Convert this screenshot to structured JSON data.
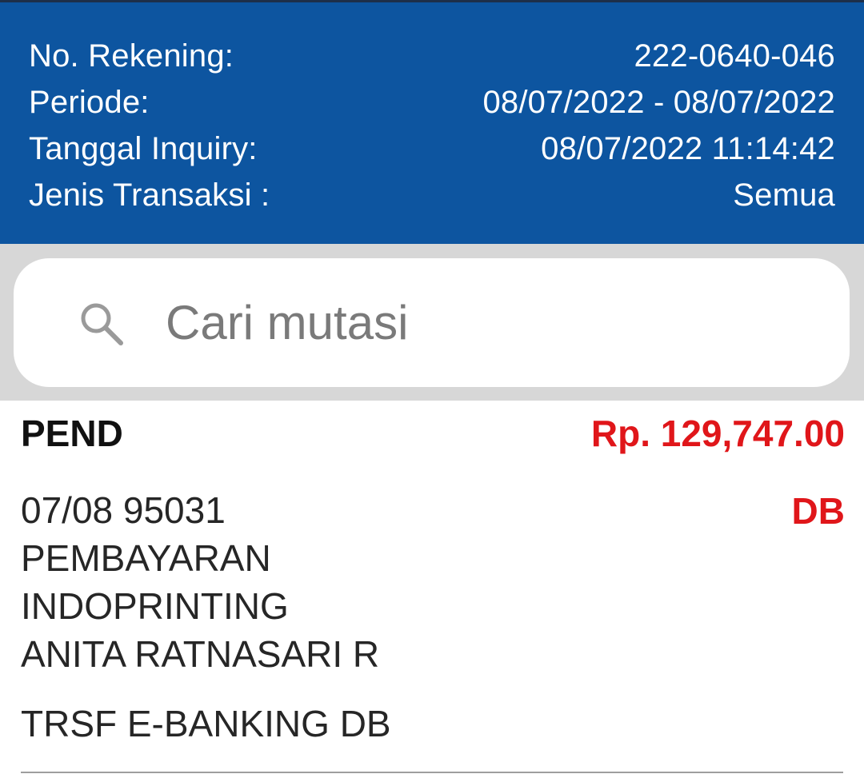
{
  "account_info": [
    {
      "label": "No. Rekening:",
      "value": "222-0640-046"
    },
    {
      "label": "Periode:",
      "value": "08/07/2022 - 08/07/2022"
    },
    {
      "label": "Tanggal Inquiry:",
      "value": "08/07/2022 11:14:42"
    },
    {
      "label": "Jenis Transaksi :",
      "value": "Semua"
    }
  ],
  "search": {
    "placeholder": "Cari mutasi",
    "icon": "search-icon"
  },
  "transaction": {
    "type": "PEND",
    "amount": "Rp. 129,747.00",
    "dc": "DB",
    "lines": [
      "07/08 95031",
      "PEMBAYARAN",
      "INDOPRINTING",
      "ANITA RATNASARI R",
      "TRSF E-BANKING DB"
    ]
  },
  "colors": {
    "header_bg": "#0d55a0",
    "amount_red": "#e0161a",
    "search_bg": "#d7d7d7"
  }
}
